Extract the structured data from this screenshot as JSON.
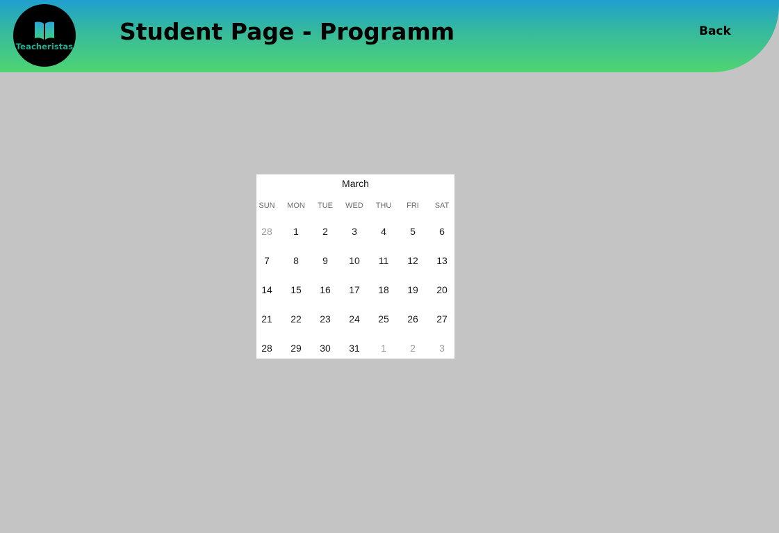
{
  "header": {
    "logo_text": "Teacheristas",
    "title": "Student Page - Programm",
    "back_label": "Back"
  },
  "colors": {
    "header_gradient_top": "#1f9fcf",
    "header_gradient_bottom": "#4fd472",
    "logo_background": "#000000",
    "logo_text": "#1fae8f",
    "page_background": "#c4c4c4"
  },
  "calendar": {
    "month": "March",
    "weekdays": [
      "SUN",
      "MON",
      "TUE",
      "WED",
      "THU",
      "FRI",
      "SAT"
    ],
    "weeks": [
      [
        {
          "d": "28",
          "muted": true
        },
        {
          "d": "1"
        },
        {
          "d": "2"
        },
        {
          "d": "3"
        },
        {
          "d": "4"
        },
        {
          "d": "5"
        },
        {
          "d": "6"
        }
      ],
      [
        {
          "d": "7"
        },
        {
          "d": "8"
        },
        {
          "d": "9"
        },
        {
          "d": "10"
        },
        {
          "d": "11"
        },
        {
          "d": "12"
        },
        {
          "d": "13"
        }
      ],
      [
        {
          "d": "14"
        },
        {
          "d": "15"
        },
        {
          "d": "16"
        },
        {
          "d": "17"
        },
        {
          "d": "18"
        },
        {
          "d": "19"
        },
        {
          "d": "20"
        }
      ],
      [
        {
          "d": "21"
        },
        {
          "d": "22"
        },
        {
          "d": "23"
        },
        {
          "d": "24"
        },
        {
          "d": "25"
        },
        {
          "d": "26"
        },
        {
          "d": "27"
        }
      ],
      [
        {
          "d": "28"
        },
        {
          "d": "29"
        },
        {
          "d": "30"
        },
        {
          "d": "31"
        },
        {
          "d": "1",
          "muted": true
        },
        {
          "d": "2",
          "muted": true
        },
        {
          "d": "3",
          "muted": true
        }
      ]
    ]
  }
}
